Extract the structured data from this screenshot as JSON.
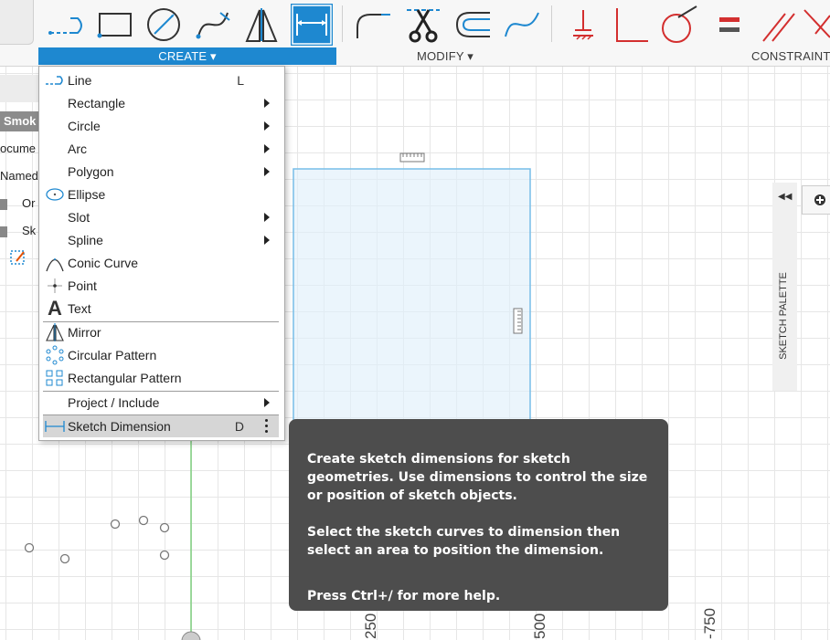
{
  "toolbar": {
    "groups": {
      "create": "CREATE ▾",
      "modify": "MODIFY ▾",
      "constraints": "CONSTRAINTS"
    }
  },
  "left_panel": {
    "rows": [
      "Smok",
      "ocume",
      "Named",
      "Or",
      "Sk"
    ]
  },
  "create_menu": {
    "items": [
      {
        "label": "Line",
        "shortcut": "L"
      },
      {
        "label": "Rectangle"
      },
      {
        "label": "Circle"
      },
      {
        "label": "Arc"
      },
      {
        "label": "Polygon"
      },
      {
        "label": "Ellipse"
      },
      {
        "label": "Slot"
      },
      {
        "label": "Spline"
      },
      {
        "label": "Conic Curve"
      },
      {
        "label": "Point"
      },
      {
        "label": "Text"
      },
      {
        "label": "Mirror"
      },
      {
        "label": "Circular Pattern"
      },
      {
        "label": "Rectangular Pattern"
      },
      {
        "label": "Project / Include"
      },
      {
        "label": "Sketch Dimension",
        "shortcut": "D"
      }
    ]
  },
  "tooltip": {
    "p1": "Create sketch dimensions for sketch geometries. Use dimensions to control the size or position of sketch objects.",
    "p2": "Select the sketch curves to dimension then select an area to position the dimension.",
    "p3": "Press Ctrl+/ for more help."
  },
  "sketch_palette": {
    "label": "SKETCH PALETTE"
  },
  "axis": {
    "labels": [
      "250",
      "500",
      "-750"
    ]
  },
  "colors": {
    "accent": "#1e88d0",
    "constraint_red": "#d32f2f",
    "tooltip_bg": "#4d4d4d"
  }
}
